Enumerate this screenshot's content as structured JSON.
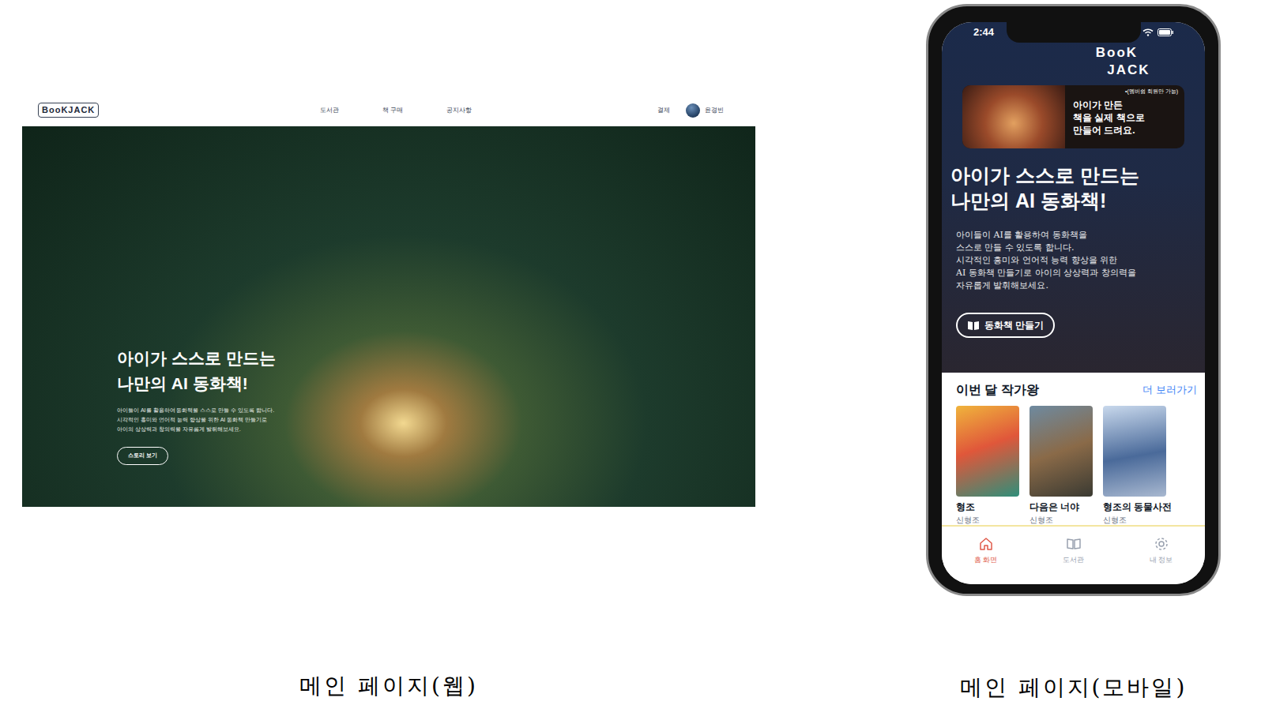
{
  "web": {
    "logo": "BooKJACK",
    "nav": [
      {
        "label": "도서관"
      },
      {
        "label": "책 구매"
      },
      {
        "label": "공지사항"
      }
    ],
    "payment": "결제",
    "user": "윤경빈",
    "hero": {
      "title": [
        "아이가 스스로 만드는",
        "나만의 AI 동화책!"
      ],
      "description": [
        "아이들이 AI를 활용하여 동화책을 스스로 만들 수 있도록 합니다.",
        "시각적인 흥미와 언어적 능력 향상을 위한 AI 동화책 만들기로",
        "아이의 상상력과 창의력을 자유롭게 발휘해보세요."
      ],
      "button": "스토리 보기"
    }
  },
  "mobile": {
    "time": "2:44",
    "logo": [
      "BooK",
      "JACK"
    ],
    "banner": {
      "note": "•(멤버쉽 회원만 가능)",
      "text": [
        "아이가 만든",
        "책을 실제 책으로",
        "만들어 드려요."
      ]
    },
    "hero": {
      "title": [
        "아이가 스스로 만드는",
        "나만의 AI 동화책!"
      ],
      "description": [
        "아이들이 AI를 활용하여 동화책을",
        "스스로 만들 수 있도록 합니다.",
        "시각적인 흥미와 언어적 능력 향상을 위한",
        "AI 동화책 만들기로 아이의 상상력과 창의력을",
        "자유롭게 발휘해보세요."
      ],
      "button": "동화책 만들기"
    },
    "section": {
      "title": "이번 달 작가왕",
      "more": "더 보러가기",
      "books": [
        {
          "title": "형조",
          "author": "신형조"
        },
        {
          "title": "다음은 너야",
          "author": "신형조"
        },
        {
          "title": "형조의 동물사전",
          "author": "신형조"
        }
      ]
    },
    "tabs": [
      {
        "label": "홈 화면",
        "selected": true
      },
      {
        "label": "도서관",
        "selected": false
      },
      {
        "label": "내 정보",
        "selected": false
      }
    ]
  },
  "captions": [
    "메인 페이지(웹)",
    "메인 페이지(모바일)"
  ]
}
